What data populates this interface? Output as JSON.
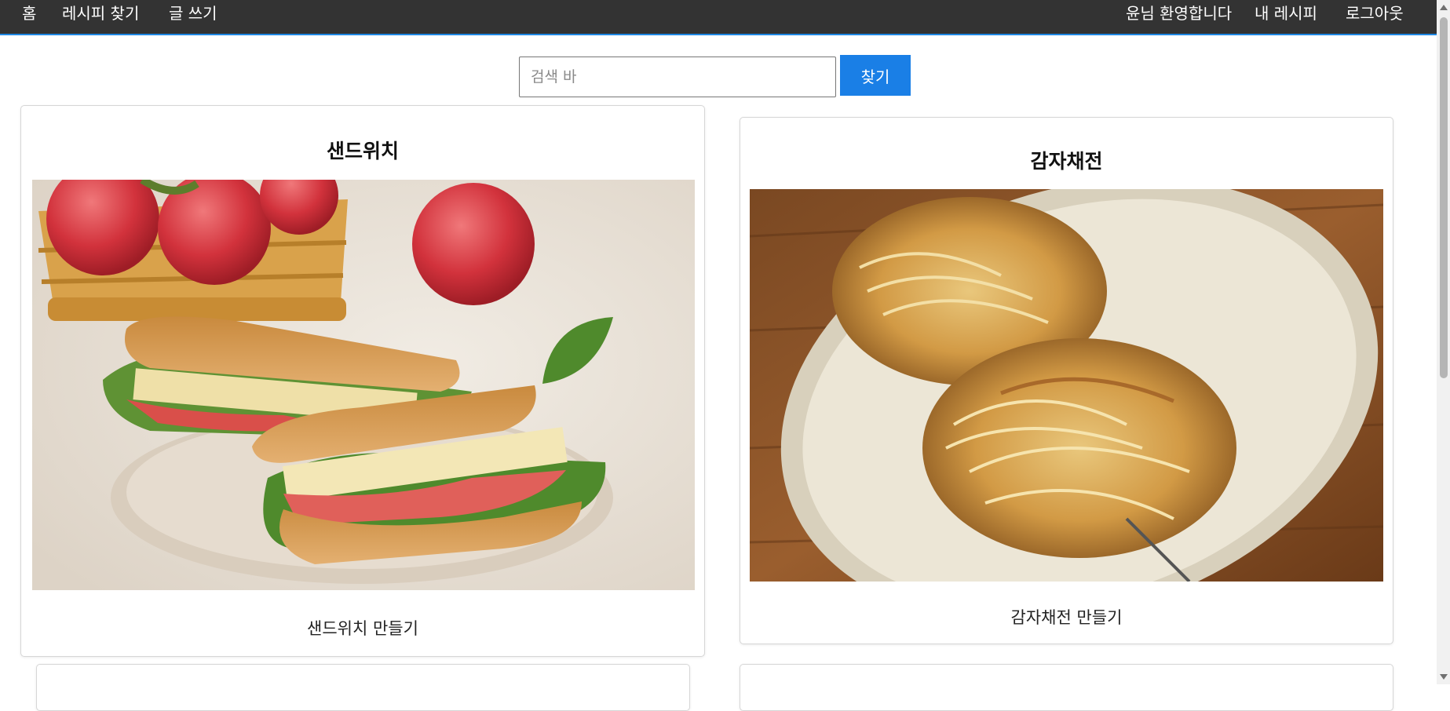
{
  "nav": {
    "home": "홈",
    "find_recipe": "레시피 찾기",
    "write": "글 쓰기",
    "welcome": "윤님 환영합니다",
    "my_recipe": "내 레시피",
    "logout": "로그아웃"
  },
  "search": {
    "placeholder": "검색 바",
    "value": "",
    "button_label": "찾기"
  },
  "recipes": [
    {
      "title": "샌드위치",
      "description": "샌드위치 만들기",
      "image": "sandwich-photo"
    },
    {
      "title": "감자채전",
      "description": "감자채전 만들기",
      "image": "potato-pancake-photo"
    }
  ],
  "colors": {
    "navbar": "#333333",
    "navbar_border": "#1e88e5",
    "accent": "#1a7fe6"
  }
}
